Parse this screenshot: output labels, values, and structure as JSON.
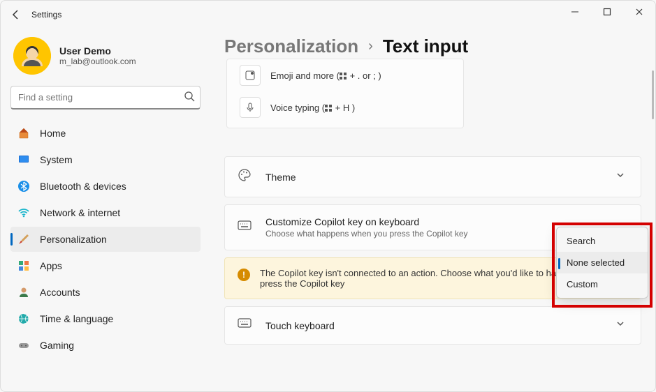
{
  "window": {
    "title": "Settings"
  },
  "user": {
    "name": "User Demo",
    "email": "m_lab@outlook.com"
  },
  "search": {
    "placeholder": "Find a setting"
  },
  "nav": {
    "items": [
      {
        "label": "Home"
      },
      {
        "label": "System"
      },
      {
        "label": "Bluetooth & devices"
      },
      {
        "label": "Network & internet"
      },
      {
        "label": "Personalization"
      },
      {
        "label": "Apps"
      },
      {
        "label": "Accounts"
      },
      {
        "label": "Time & language"
      },
      {
        "label": "Gaming"
      }
    ]
  },
  "breadcrumb": {
    "parent": "Personalization",
    "current": "Text input"
  },
  "shortcuts": {
    "emoji": {
      "label": "Emoji and more (",
      "suffix": " + . or ; )"
    },
    "voice": {
      "label": "Voice typing (",
      "suffix": " + H )"
    }
  },
  "settings": {
    "theme": {
      "title": "Theme"
    },
    "copilot": {
      "title": "Customize Copilot key on keyboard",
      "subtitle": "Choose what happens when you press the Copilot key"
    },
    "touch": {
      "title": "Touch keyboard"
    }
  },
  "warning": {
    "text": "The Copilot key isn't connected to an action. Choose what you'd like to happen when you press the Copilot key"
  },
  "dropdown": {
    "options": [
      {
        "label": "Search"
      },
      {
        "label": "None selected"
      },
      {
        "label": "Custom"
      }
    ],
    "selected": "None selected"
  }
}
